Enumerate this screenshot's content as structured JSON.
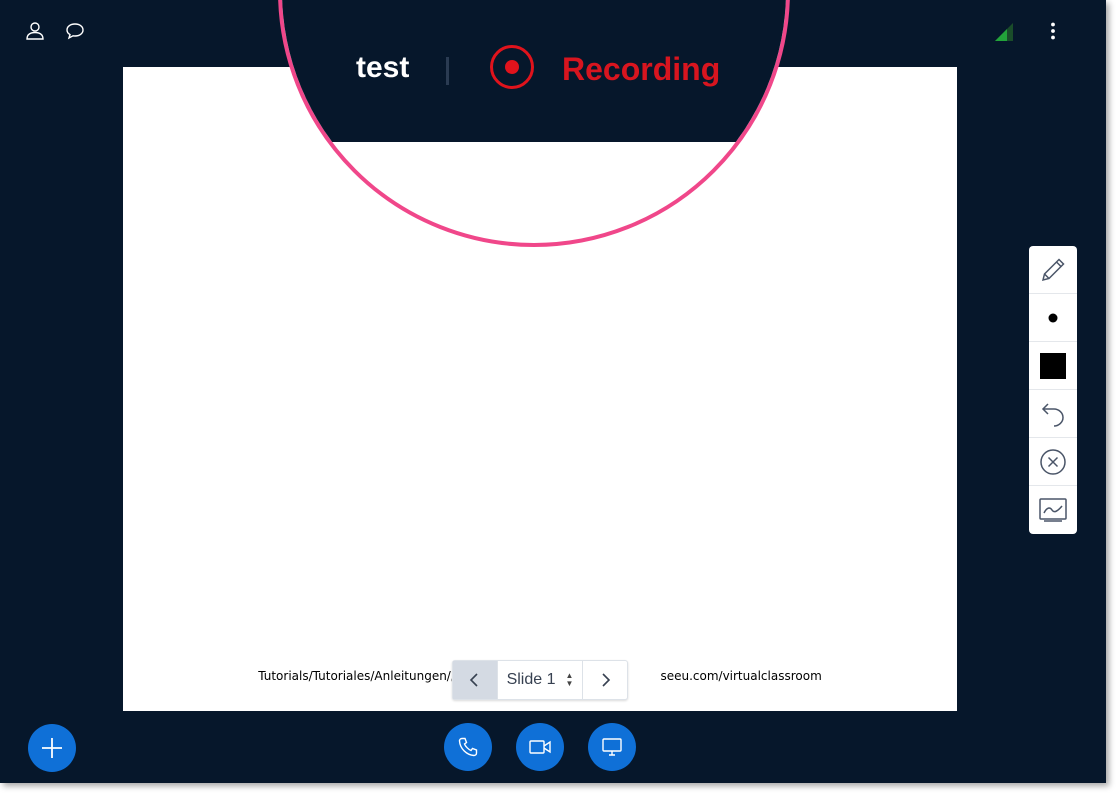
{
  "header": {
    "meeting_title": "test",
    "recording_label": "Recording",
    "icons": [
      "user-icon",
      "chat-icon",
      "connection-signal-icon",
      "more-vertical-icon"
    ]
  },
  "presentation": {
    "footer_left": "Tutorials/Tutoriales/Anleitungen/دروس",
    "footer_right": "seeu.com/virtualclassroom",
    "pager": {
      "current_slide": "Slide 1"
    }
  },
  "toolbar": {
    "tools": [
      "pencil-icon",
      "thickness-dot-icon",
      "color-swatch-icon",
      "undo-icon",
      "clear-icon",
      "multi-user-whiteboard-icon"
    ]
  },
  "bottom_actions": [
    "add-icon",
    "phone-icon",
    "video-camera-icon",
    "screen-share-icon"
  ],
  "colors": {
    "background": "#06172b",
    "accent": "#0f70d7",
    "recording": "#e0131c",
    "magnifier_ring": "#f0478a",
    "signal": "#22a33a"
  }
}
